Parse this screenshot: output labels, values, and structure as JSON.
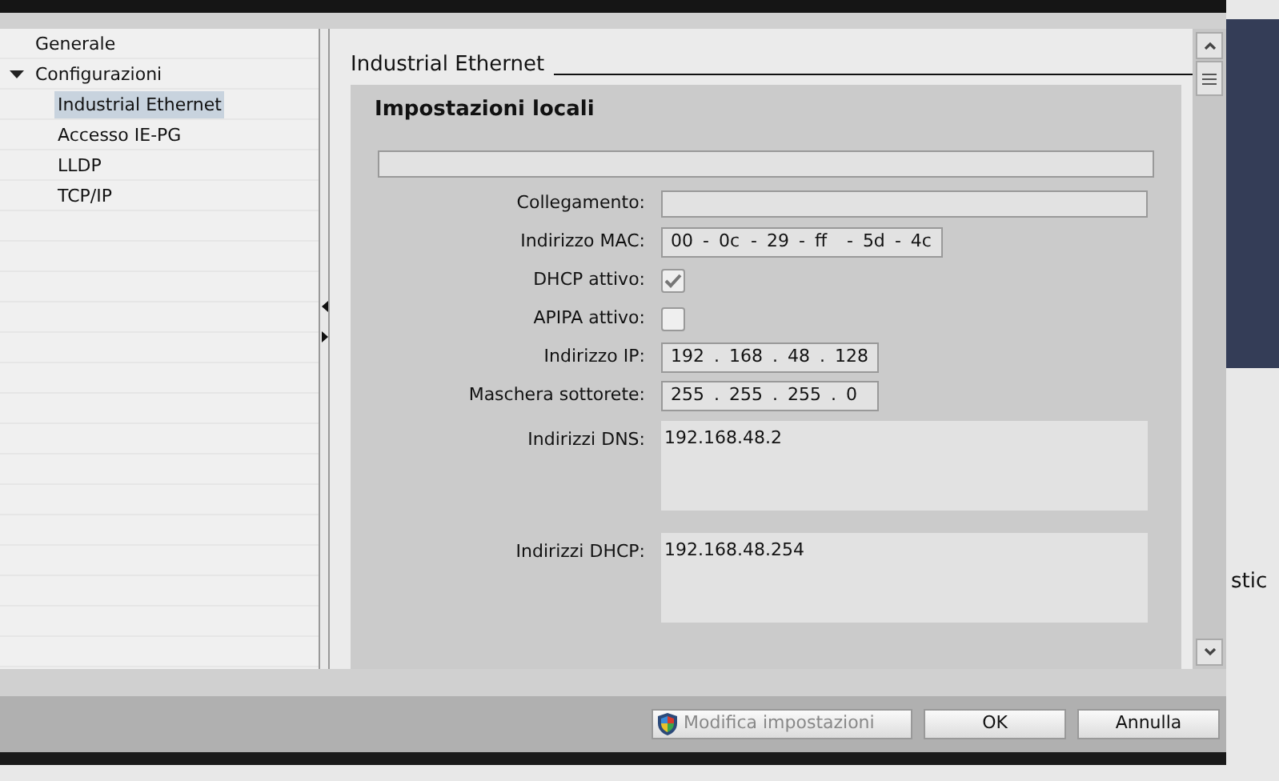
{
  "tree": [
    {
      "label": "Generale",
      "selected": false
    },
    {
      "label": "Configurazioni",
      "expanded": true,
      "selected": false,
      "children": [
        {
          "label": "Industrial Ethernet",
          "selected": true
        },
        {
          "label": "Accesso IE-PG",
          "selected": false
        },
        {
          "label": "LLDP",
          "selected": false
        },
        {
          "label": "TCP/IP",
          "selected": false
        }
      ]
    }
  ],
  "section_title": "Industrial Ethernet",
  "group_title": "Impostazioni locali",
  "fields": [
    {
      "kind": "bar"
    },
    {
      "kind": "text",
      "label": "Collegamento:"
    },
    {
      "kind": "segments",
      "label": "Indirizzo MAC:",
      "parts": [
        "00",
        "0c",
        "29",
        "ff",
        "5d",
        "4c"
      ],
      "separator": "-"
    },
    {
      "kind": "checkbox",
      "label": "DHCP attivo:",
      "checked": true
    },
    {
      "kind": "checkbox",
      "label": "APIPA attivo:",
      "checked": false
    },
    {
      "kind": "segments",
      "label": "Indirizzo IP:",
      "parts": [
        "192",
        "168",
        "48",
        "128"
      ],
      "separator": "."
    },
    {
      "kind": "segments",
      "label": "Maschera sottorete:",
      "parts": [
        "255",
        "255",
        "255",
        "0"
      ],
      "separator": "."
    },
    {
      "kind": "area",
      "label": "Indirizzi DNS:",
      "value": "192.168.48.2"
    },
    {
      "kind": "area",
      "label": "Indirizzi DHCP:",
      "value": "192.168.48.254"
    }
  ],
  "buttons": [
    {
      "label": "Modifica impostazioni",
      "kind": "shield",
      "disabled": true
    },
    {
      "label": "OK",
      "disabled": false
    },
    {
      "label": "Annulla",
      "disabled": false
    }
  ],
  "background_text": "stic"
}
